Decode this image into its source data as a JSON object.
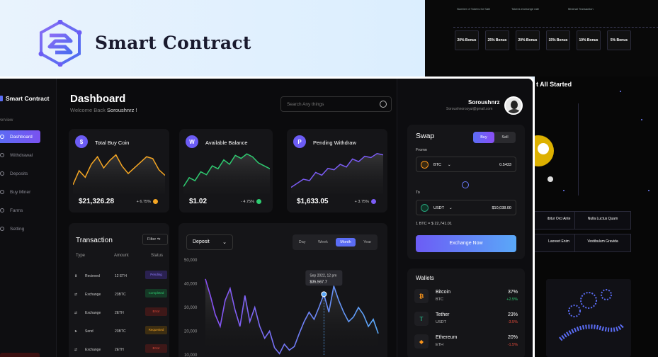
{
  "brand": {
    "title": "Smart Contract"
  },
  "top_preview": {
    "labels": [
      "Number of Tokens for Sale",
      "Tokens exchange rate",
      "Minimal Transaction"
    ],
    "bonuses": [
      "20% Bonus",
      "25% Bonus",
      "20% Bonus",
      "15% Bonus",
      "10% Bonus",
      "5% Bonus"
    ]
  },
  "side_preview": {
    "title": "t All Started",
    "boxes": [
      "Nulla Luctus Quam",
      "Vestibulum Gravida"
    ],
    "left_boxes": [
      "ibitur Orci Ante",
      "Laoreet Enim"
    ]
  },
  "sidebar": {
    "logo": "Smart Contract",
    "section": "verview",
    "items": [
      {
        "label": "Dashboard",
        "active": true
      },
      {
        "label": "Withdrawal"
      },
      {
        "label": "Deposits"
      },
      {
        "label": "Buy Miner"
      },
      {
        "label": "Farms"
      },
      {
        "label": "Setting"
      }
    ]
  },
  "header": {
    "title": "Dashboard",
    "welcome": "Welcome Back",
    "user": "Soroushnrz !",
    "search_placeholder": "Search Any things"
  },
  "user": {
    "name": "Soroushnrz",
    "email": "Soroushnorozyui@gmail.com"
  },
  "kpis": [
    {
      "title": "Total Buy Coin",
      "value": "$21,326.28",
      "change": "+ 6.75%",
      "icon": "coin-icon",
      "color": "#f5a623"
    },
    {
      "title": "Available Balance",
      "value": "$1.02",
      "change": "- 4.75%",
      "icon": "wallet-icon",
      "color": "#2ecc71"
    },
    {
      "title": "Pending Withdraw",
      "value": "$1,633.05",
      "change": "+ 3.75%",
      "icon": "withdraw-icon",
      "color": "#7b5cf5"
    }
  ],
  "transaction": {
    "title": "Transaction",
    "filter": "Filter",
    "headers": [
      "Type",
      "Amount",
      "Status"
    ],
    "rows": [
      {
        "type": "Recieved",
        "amount": "12 ETH",
        "status": "Pending",
        "color": "#7b5cf5"
      },
      {
        "type": "Exchange",
        "amount": "23BTC",
        "status": "Completed",
        "color": "#2ecc71"
      },
      {
        "type": "Exchange",
        "amount": "2ETH",
        "status": "Error",
        "color": "#e74c3c"
      },
      {
        "type": "Send",
        "amount": "23BTC",
        "status": "Requested",
        "color": "#f5a623"
      },
      {
        "type": "Exchange",
        "amount": "2ETH",
        "status": "Error",
        "color": "#e74c3c"
      }
    ]
  },
  "deposit": {
    "select": "Deposit",
    "tabs": [
      "Day",
      "Week",
      "Month",
      "Year"
    ],
    "active_tab": "Month",
    "tooltip_date": "Sep 2022, 12 pm",
    "tooltip_value": "$35,567.7"
  },
  "swap": {
    "title": "Swap",
    "buy": "Buy",
    "sell": "Sell",
    "from_label": "Fromn",
    "to_label": "To",
    "from": {
      "coin": "BTC",
      "amount": "0.5433"
    },
    "to": {
      "coin": "USDT",
      "amount": "$10,038.00"
    },
    "rate": "1 BTC = $ 22,741.01",
    "button": "Exchange Now"
  },
  "wallets": {
    "title": "Wallets",
    "items": [
      {
        "name": "Bitcoin",
        "symbol": "BTC",
        "pct": "37%",
        "change": "+2.5%",
        "color": "#f7931a",
        "glyph": "₿"
      },
      {
        "name": "Tether",
        "symbol": "USDT",
        "pct": "23%",
        "change": "-3.5%",
        "color": "#26a17b",
        "glyph": "T"
      },
      {
        "name": "Ethereum",
        "symbol": "ETH",
        "pct": "20%",
        "change": "-1.5%",
        "color": "#f7931a",
        "glyph": "◆"
      }
    ]
  },
  "chart_data": [
    {
      "type": "area",
      "series": [
        {
          "values": [
            40,
            55,
            48,
            62,
            70,
            58,
            66,
            72,
            60,
            52,
            58,
            64,
            70,
            68,
            56,
            50
          ]
        }
      ]
    },
    {
      "type": "area",
      "series": [
        {
          "values": [
            30,
            42,
            38,
            50,
            46,
            58,
            54,
            66,
            60,
            72,
            68,
            74,
            70,
            62,
            58,
            54
          ]
        }
      ]
    },
    {
      "type": "area",
      "series": [
        {
          "values": [
            28,
            34,
            40,
            38,
            50,
            46,
            56,
            54,
            62,
            58,
            70,
            66,
            74,
            72,
            78,
            76
          ]
        }
      ]
    },
    {
      "type": "area",
      "yticks": [
        "50,000",
        "40,000",
        "30,000",
        "20,000",
        "10,000"
      ],
      "ylim": [
        10000,
        50000
      ],
      "series": [
        {
          "values": [
            42000,
            35000,
            27000,
            22000,
            33000,
            38000,
            29000,
            22000,
            35000,
            24000,
            30000,
            22000,
            17000,
            20000,
            13000,
            10500,
            14500,
            12000,
            13500,
            19000,
            24000,
            28000,
            25000,
            30000,
            35567,
            28000,
            39000,
            33000,
            28000,
            24000,
            26000,
            30000,
            27000,
            22000,
            25000,
            19000
          ]
        }
      ]
    }
  ]
}
